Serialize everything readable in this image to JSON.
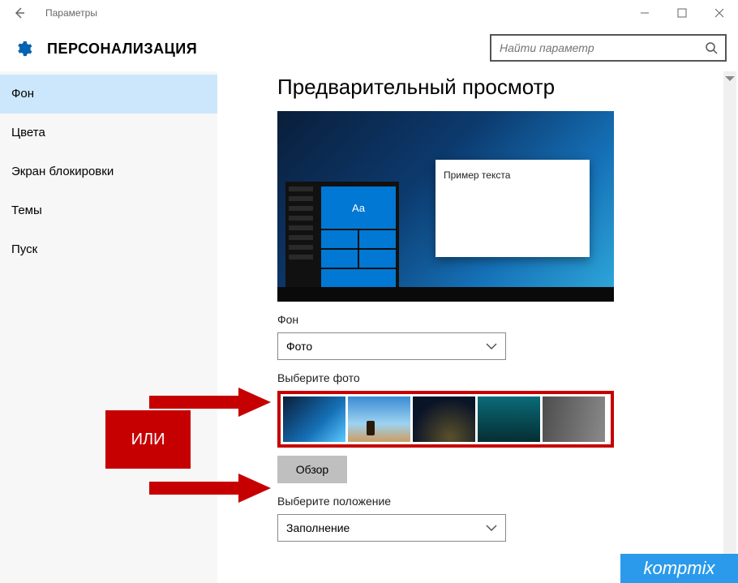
{
  "titlebar": {
    "title": "Параметры"
  },
  "header": {
    "title": "ПЕРСОНАЛИЗАЦИЯ"
  },
  "search": {
    "placeholder": "Найти параметр"
  },
  "sidebar": {
    "items": [
      {
        "label": "Фон",
        "selected": true
      },
      {
        "label": "Цвета",
        "selected": false
      },
      {
        "label": "Экран блокировки",
        "selected": false
      },
      {
        "label": "Темы",
        "selected": false
      },
      {
        "label": "Пуск",
        "selected": false
      }
    ]
  },
  "main": {
    "preview_heading": "Предварительный просмотр",
    "preview_sample_text": "Пример текста",
    "preview_tile_text": "Aa",
    "background": {
      "label": "Фон",
      "value": "Фото"
    },
    "choose_photo": {
      "label": "Выберите фото"
    },
    "browse": {
      "label": "Обзор"
    },
    "position": {
      "label": "Выберите положение",
      "value": "Заполнение"
    }
  },
  "annotation": {
    "or_text": "ИЛИ"
  },
  "watermark": {
    "text": "kompmix"
  }
}
